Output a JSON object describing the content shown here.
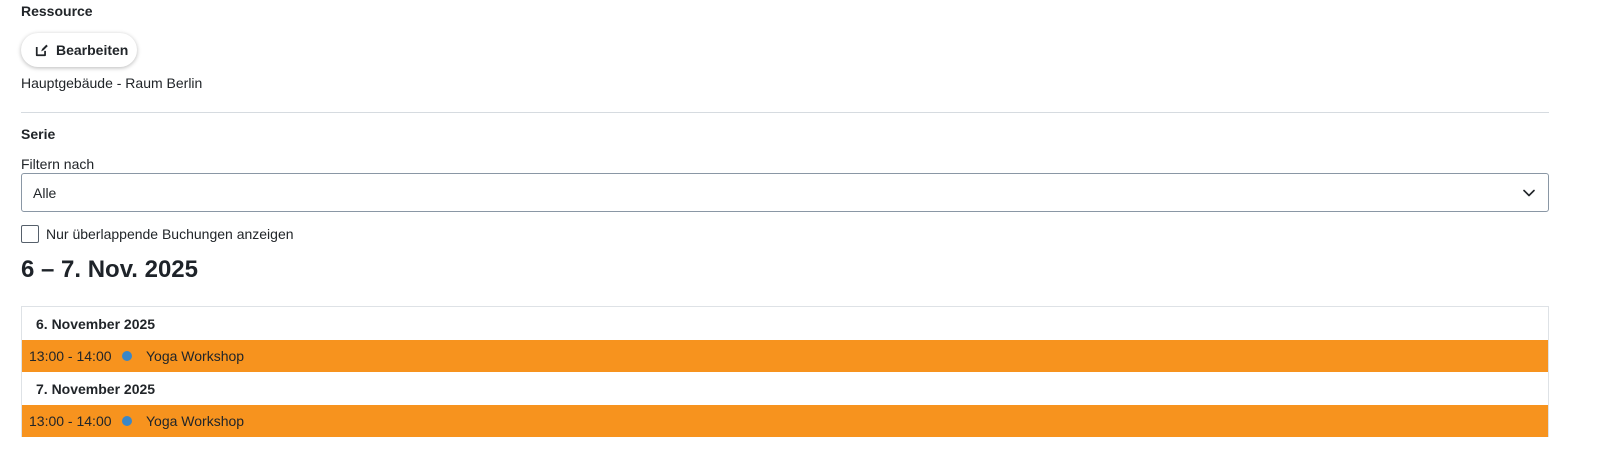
{
  "resource": {
    "section_label": "Ressource",
    "edit_label": "Bearbeiten",
    "value": "Hauptgebäude - Raum Berlin"
  },
  "series": {
    "section_label": "Serie",
    "filter_label": "Filtern nach",
    "filter_selected": "Alle",
    "overlap_checkbox_label": "Nur überlappende Buchungen anzeigen",
    "overlap_checked": false
  },
  "calendar": {
    "range_title": "6 – 7. Nov. 2025",
    "days": [
      {
        "date_label": "6. November 2025",
        "events": [
          {
            "time": "13:00 - 14:00",
            "title": "Yoga Workshop"
          }
        ]
      },
      {
        "date_label": "7. November 2025",
        "events": [
          {
            "time": "13:00 - 14:00",
            "title": "Yoga Workshop"
          }
        ]
      }
    ]
  },
  "colors": {
    "event_background": "#f7931e",
    "event_dot": "#3a87c8",
    "divider": "#d6dbe0"
  },
  "icons": {
    "edit_button": "edit-icon",
    "select": "chevron-down-icon"
  }
}
